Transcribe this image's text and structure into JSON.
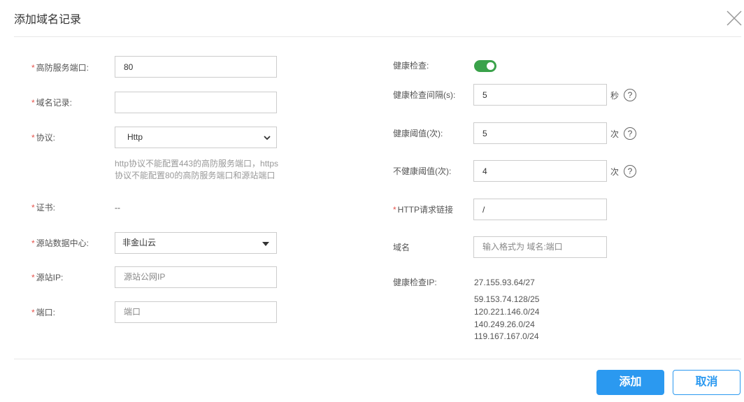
{
  "dialog": {
    "title": "添加域名记录"
  },
  "left": {
    "port_label": "高防服务端口:",
    "port_value": "80",
    "domain_label": "域名记录:",
    "domain_value": "",
    "protocol_label": "协议:",
    "protocol_value": "Http",
    "protocol_hint_1": "http协议不能配置443的高防服务端口，https",
    "protocol_hint_2": "协议不能配置80的高防服务端口和源站端口",
    "cert_label": "证书:",
    "cert_value": "--",
    "dc_label": "源站数据中心:",
    "dc_value": "非金山云",
    "ip_label": "源站IP:",
    "ip_placeholder": "源站公网IP",
    "sport_label": "端口:",
    "sport_placeholder": "端口"
  },
  "right": {
    "hc_label": "健康检查:",
    "hc_enabled": true,
    "interval_label": "健康检查间隔(s):",
    "interval_value": "5",
    "interval_unit": "秒",
    "healthy_label": "健康阈值(次):",
    "healthy_value": "5",
    "healthy_unit": "次",
    "unhealthy_label": "不健康阈值(次):",
    "unhealthy_value": "4",
    "unhealthy_unit": "次",
    "url_label": "HTTP请求链接",
    "url_value": "/",
    "host_label": "域名",
    "host_placeholder": "输入格式为 域名:端口",
    "hcip_label": "健康检查IP:",
    "hc_ips": [
      "27.155.93.64/27",
      "59.153.74.128/25",
      "120.221.146.0/24",
      "140.249.26.0/24",
      "119.167.167.0/24"
    ]
  },
  "help_glyph": "?",
  "required_mark": "*",
  "footer": {
    "add": "添加",
    "cancel": "取消"
  }
}
